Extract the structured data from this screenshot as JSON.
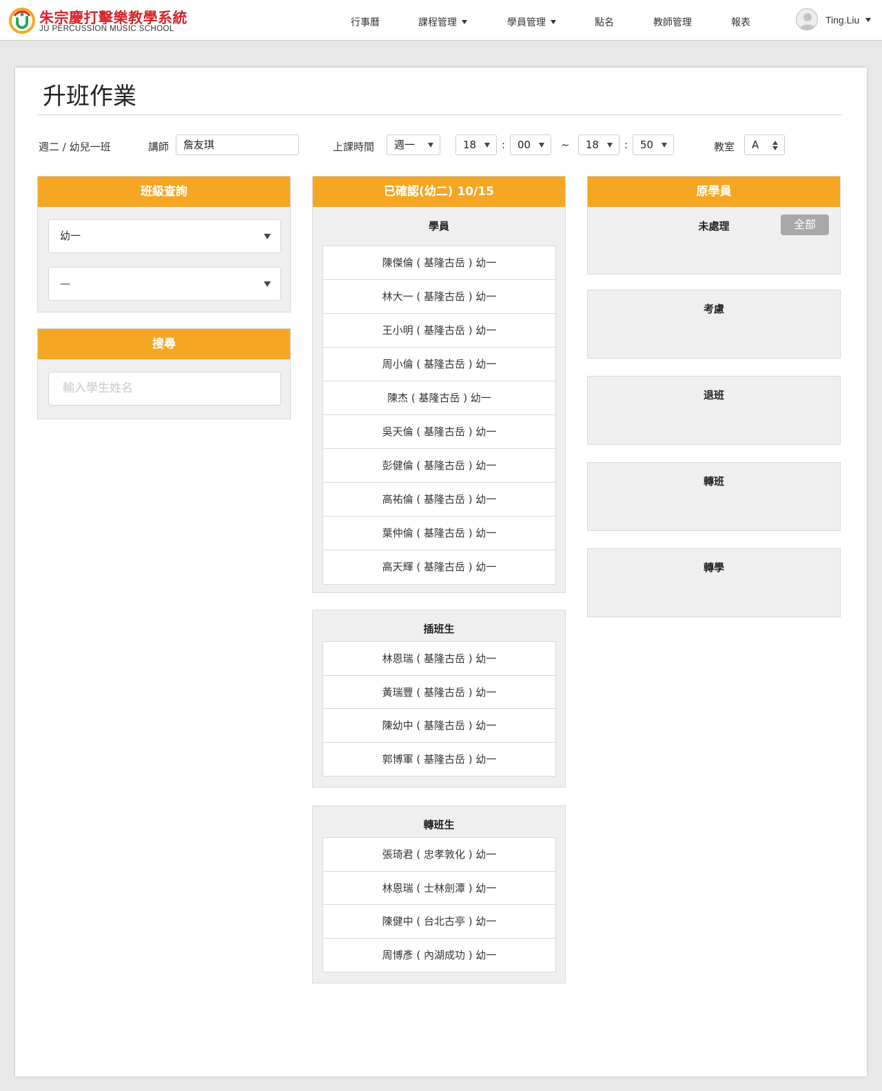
{
  "brand": {
    "name_cn": "朱宗慶打擊樂教學系統",
    "name_en": "JU PERCUSSION MUSIC SCHOOL",
    "logo_icon": "ju-logo-icon"
  },
  "nav": {
    "items": [
      {
        "label": "行事曆",
        "dropdown": false
      },
      {
        "label": "課程管理",
        "dropdown": true
      },
      {
        "label": "學員管理",
        "dropdown": true
      },
      {
        "label": "點名",
        "dropdown": false
      },
      {
        "label": "教師管理",
        "dropdown": false
      },
      {
        "label": "報表",
        "dropdown": false
      }
    ],
    "user": {
      "name": "Ting.Liu",
      "avatar_icon": "user-avatar-icon"
    }
  },
  "page": {
    "title": "升班作業"
  },
  "form": {
    "class_label": "週二 / 幼兒一班",
    "teacher_label": "講師",
    "teacher_value": "詹友琪",
    "time_label": "上課時間",
    "weekday": "週一",
    "start_hour": "18",
    "start_min": "00",
    "tilde": "~",
    "end_hour": "18",
    "end_min": "50",
    "colon": ":",
    "room_label": "教室",
    "room_value": "A"
  },
  "class_query": {
    "title": "班級查詢",
    "select1": "幼一",
    "select2": "—"
  },
  "search": {
    "title": "搜尋",
    "placeholder": "輸入學生姓名"
  },
  "confirmed": {
    "title": "已確認(幼二) 10/15",
    "students_title": "學員",
    "students": [
      "陳傑倫 ( 基隆古岳 ) 幼一",
      "林大一 ( 基隆古岳 ) 幼一",
      "王小明 ( 基隆古岳 ) 幼一",
      "周小倫 ( 基隆古岳 ) 幼一",
      "陳杰 ( 基隆古岳 ) 幼一",
      "吳天倫 ( 基隆古岳 ) 幼一",
      "彭健倫 ( 基隆古岳 ) 幼一",
      "高祐倫 ( 基隆古岳 ) 幼一",
      "葉仲倫 ( 基隆古岳 ) 幼一",
      "高天輝 ( 基隆古岳 ) 幼一"
    ],
    "transfer_in_title": "插班生",
    "transfer_in": [
      "林恩瑞 ( 基隆古岳 ) 幼一",
      "黃瑞豐 ( 基隆古岳 ) 幼一",
      "陳幼中 ( 基隆古岳 ) 幼一",
      "郭博軍 ( 基隆古岳 ) 幼一"
    ],
    "class_transfer_title": "轉班生",
    "class_transfer": [
      "張琦君 ( 忠孝敦化 ) 幼一",
      "林恩瑞 ( 士林劍潭 ) 幼一",
      "陳健中 ( 台北古亭 ) 幼一",
      "周博彥 ( 內湖成功 ) 幼一"
    ]
  },
  "original": {
    "title": "原學員",
    "pending_title": "未處理",
    "all_button": "全部",
    "considering_title": "考慮",
    "withdraw_title": "退班",
    "switch_class_title": "轉班",
    "transfer_school_title": "轉學"
  }
}
